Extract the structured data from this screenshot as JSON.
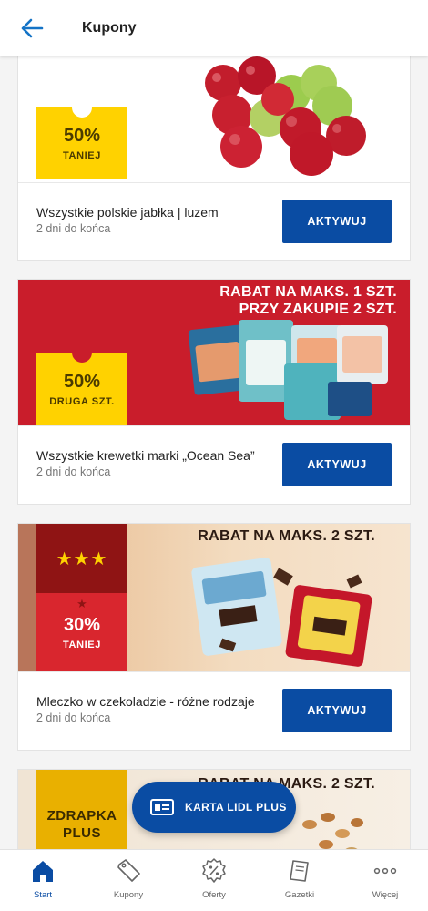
{
  "header": {
    "title": "Kupony"
  },
  "coupons": [
    {
      "badge_value": "50%",
      "badge_label": "TANIEJ",
      "name": "Wszystkie polskie jabłka | luzem",
      "expiry": "2 dni do końca",
      "action": "AKTYWUJ"
    },
    {
      "badge_value": "50%",
      "badge_label": "DRUGA SZT.",
      "promo_line1": "RABAT NA MAKS. 1 SZT.",
      "promo_line2": "PRZY ZAKUPIE 2 SZT.",
      "name": "Wszystkie krewetki marki „Ocean Sea”",
      "expiry": "2 dni do końca",
      "action": "AKTYWUJ"
    },
    {
      "badge_value": "30%",
      "badge_label": "TANIEJ",
      "badge_stars": "★★★",
      "promo_line1": "RABAT NA MAKS. 2 SZT.",
      "name": "Mleczko w czekoladzie - różne rodzaje",
      "expiry": "2 dni do końca",
      "action": "AKTYWUJ"
    },
    {
      "badge_line1": "ZDRAPKA",
      "badge_line2": "PLUS",
      "promo_line1": "RABAT NA MAKS. 2 SZT."
    }
  ],
  "fab": {
    "label": "KARTA LIDL PLUS"
  },
  "nav": [
    {
      "label": "Start",
      "icon": "home-icon",
      "active": true
    },
    {
      "label": "Kupony",
      "icon": "coupon-tag-icon",
      "active": false
    },
    {
      "label": "Oferty",
      "icon": "percent-badge-icon",
      "active": false
    },
    {
      "label": "Gazetki",
      "icon": "leaflet-icon",
      "active": false
    },
    {
      "label": "Więcej",
      "icon": "more-dots-icon",
      "active": false
    }
  ],
  "colors": {
    "brand_blue": "#0a4ca3",
    "badge_yellow": "#ffd200",
    "promo_red": "#c91d2b",
    "dark_red": "#8f1414"
  }
}
